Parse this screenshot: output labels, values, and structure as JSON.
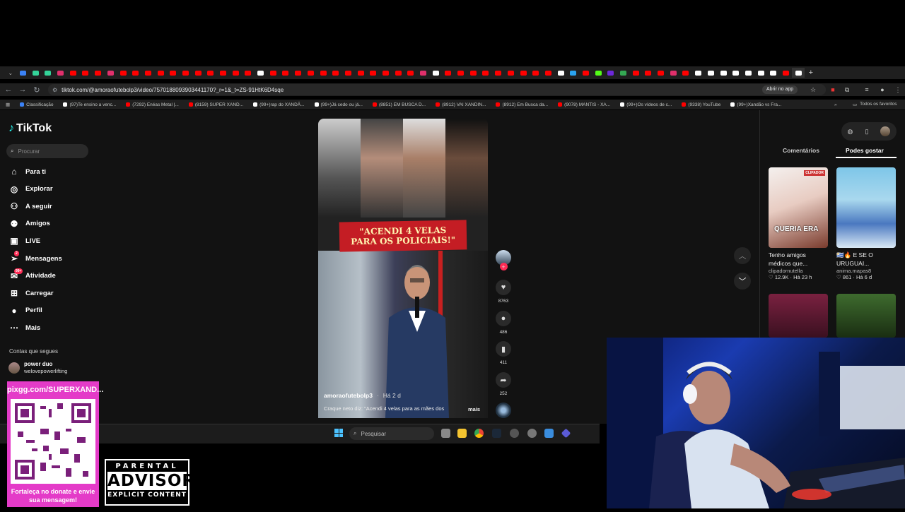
{
  "browser": {
    "url": "tiktok.com/@amoraofutebolp3/video/7570188093903441170?_r=1&_t=ZS-91HtK6D4sqe",
    "open_app": "Abrir no app",
    "tab_colors": [
      "#3b82f6",
      "#34d399",
      "#34d399",
      "#e1306c",
      "#ff0000",
      "#ff0000",
      "#ff0000",
      "#e1306c",
      "#ff0000",
      "#ff0000",
      "#ff0000",
      "#ff0000",
      "#ff0000",
      "#ff0000",
      "#ff0000",
      "#ff0000",
      "#ff0000",
      "#ff0000",
      "#ff0000",
      "#ffffff",
      "#ff0000",
      "#ff0000",
      "#ff0000",
      "#ff0000",
      "#ff0000",
      "#ff0000",
      "#ff0000",
      "#ff0000",
      "#ff0000",
      "#ff0000",
      "#ff0000",
      "#ff0000",
      "#e1306c",
      "#ffffff",
      "#ff0000",
      "#ff0000",
      "#ff0000",
      "#ff0000",
      "#ff0000",
      "#ff0000",
      "#ff0000",
      "#ff0000",
      "#ff0000",
      "#ffffff",
      "#2aa3ef",
      "#ff0000",
      "#53fc18",
      "#6d28d9",
      "#34a853",
      "#ff0000",
      "#ff0000",
      "#ff0000",
      "#e1306c",
      "#ff0000",
      "#ffffff",
      "#ffffff",
      "#ffffff",
      "#ffffff",
      "#ffffff",
      "#ffffff",
      "#ffffff",
      "#ff0000",
      "#ffffff"
    ],
    "bookmarks": [
      {
        "label": "Classificação",
        "color": "#3b82f6"
      },
      {
        "label": "(97)Te ensino a venc...",
        "color": "#ffffff"
      },
      {
        "label": "(7292) Enéas Metal |...",
        "color": "#ff0000"
      },
      {
        "label": "(8159) SUPER XAND...",
        "color": "#ff0000"
      },
      {
        "label": "(99+)rap do XANDÃ...",
        "color": "#ffffff"
      },
      {
        "label": "(99+)Já cedo ou já...",
        "color": "#ffffff"
      },
      {
        "label": "(8851) EM BUSCA D...",
        "color": "#ff0000"
      },
      {
        "label": "(8912) VAI XANDIN...",
        "color": "#ff0000"
      },
      {
        "label": "(8912) Em Busca da...",
        "color": "#ff0000"
      },
      {
        "label": "(9078) MANTIS - XA...",
        "color": "#ff0000"
      },
      {
        "label": "(99+)Os vídeos de c...",
        "color": "#ffffff"
      },
      {
        "label": "(9338) YouTube",
        "color": "#ff0000"
      },
      {
        "label": "(99+)Xandão vs Fra...",
        "color": "#ffffff"
      }
    ],
    "all_favorites": "Todos os favoritos"
  },
  "sidebar": {
    "logo": "TikTok",
    "search_placeholder": "Procurar",
    "items": [
      {
        "label": "Para ti",
        "icon": "home-icon",
        "glyph": "⌂"
      },
      {
        "label": "Explorar",
        "icon": "compass-icon",
        "glyph": "◎"
      },
      {
        "label": "A seguir",
        "icon": "following-icon",
        "glyph": "⚇"
      },
      {
        "label": "Amigos",
        "icon": "friends-icon",
        "glyph": "⚉"
      },
      {
        "label": "LIVE",
        "icon": "live-icon",
        "glyph": "▣"
      },
      {
        "label": "Mensagens",
        "icon": "messages-icon",
        "glyph": "➢",
        "badge": "2"
      },
      {
        "label": "Atividade",
        "icon": "activity-icon",
        "glyph": "✉",
        "badge": "99+"
      },
      {
        "label": "Carregar",
        "icon": "upload-icon",
        "glyph": "⊞"
      },
      {
        "label": "Perfil",
        "icon": "profile-icon",
        "glyph": "●"
      },
      {
        "label": "Mais",
        "icon": "more-icon",
        "glyph": "⋯"
      }
    ],
    "following_title": "Contas que segues",
    "following": [
      {
        "name": "power duo",
        "handle": "welovepowerlifting"
      }
    ]
  },
  "video": {
    "banner_line1": "\"ACENDI 4 VELAS",
    "banner_line2": "PARA OS POLICIAIS!\"",
    "username": "amoraofutebolp3",
    "age": "Há 2 d",
    "description": "Craque neto diz: \"Acendi 4 velas para as mães dos",
    "more": "mais",
    "likes": "8763",
    "comments": "486",
    "saves": "411",
    "shares": "252"
  },
  "right_panel": {
    "tab_comments": "Comentários",
    "tab_likes": "Podes gostar",
    "cards": [
      {
        "title": "Tenho amigos médicos que...",
        "author": "clipadornutella",
        "likes": "12.9K",
        "age": "Há 23 h",
        "overlay": "QUERIA ERA",
        "badge": "CLIPADOR"
      },
      {
        "title": "🇺🇾🔥 E SE O URUGUAI...",
        "author": "anima.mapas8",
        "likes": "861",
        "age": "Há 6 d"
      }
    ]
  },
  "taskbar": {
    "search": "Pesquisar"
  },
  "overlay": {
    "qr_url": "pixgg.com/SUPERXAND...",
    "qr_text": "Fortaleça no donate e envie sua mensagem!",
    "advisory_top": "PARENTAL",
    "advisory_mid": "ADVISORY",
    "advisory_bottom": "EXPLICIT CONTENT"
  }
}
